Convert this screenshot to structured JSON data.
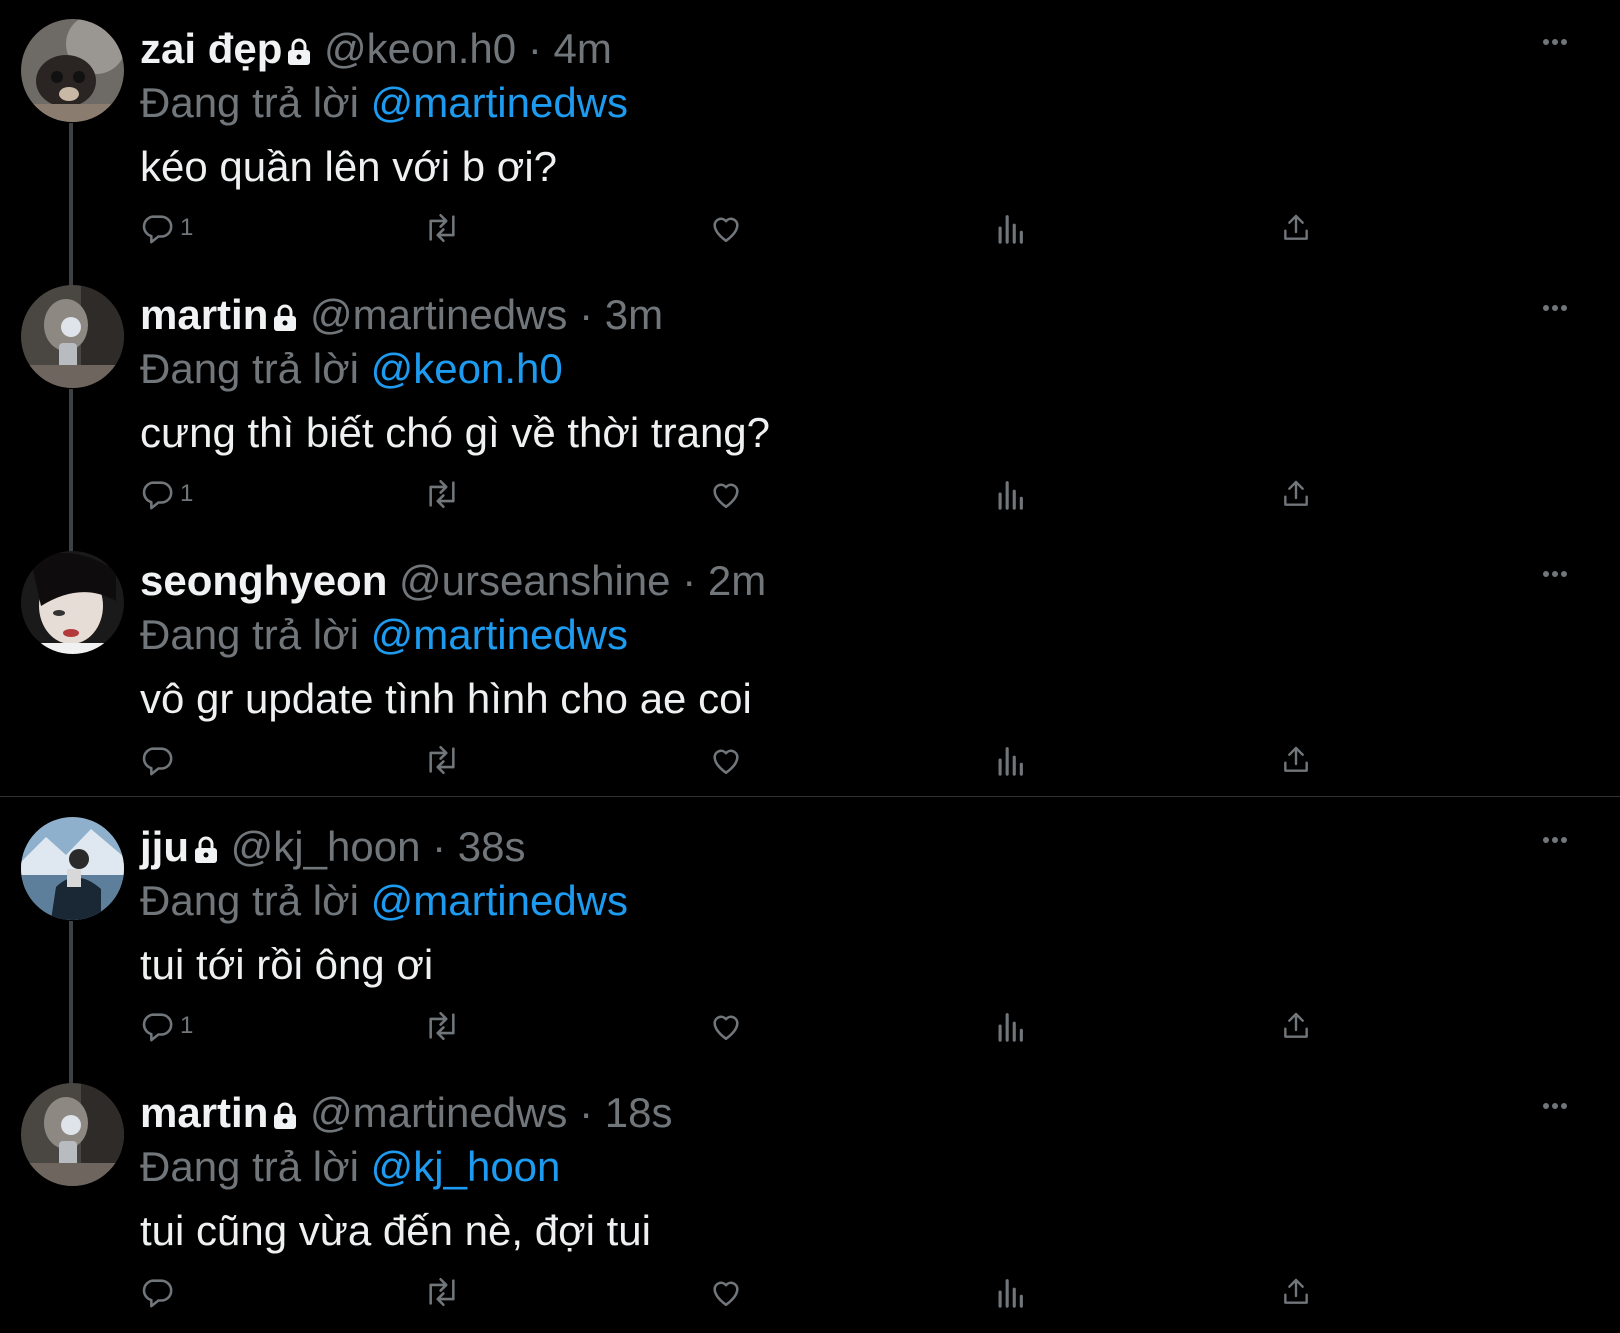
{
  "reply_prefix": "Đang trả lời",
  "tweets": [
    {
      "name": "zai đẹp",
      "locked": true,
      "handle": "@keon.h0",
      "time": "4m",
      "reply_to": "@martinedws",
      "text": "kéo quần lên với b ơi?",
      "reply_count": "1"
    },
    {
      "name": "martin",
      "locked": true,
      "handle": "@martinedws",
      "time": "3m",
      "reply_to": "@keon.h0",
      "text": "cưng thì biết chó gì về thời trang?",
      "reply_count": "1"
    },
    {
      "name": "seonghyeon",
      "locked": false,
      "handle": "@urseanshine",
      "time": "2m",
      "reply_to": "@martinedws",
      "text": "vô gr update tình hình cho ae coi",
      "reply_count": ""
    },
    {
      "name": "jju",
      "locked": true,
      "handle": "@kj_hoon",
      "time": "38s",
      "reply_to": "@martinedws",
      "text": "tui tới rồi ông ơi",
      "reply_count": "1"
    },
    {
      "name": "martin",
      "locked": true,
      "handle": "@martinedws",
      "time": "18s",
      "reply_to": "@kj_hoon",
      "text": "tui cũng vừa đến nè, đợi tui",
      "reply_count": ""
    }
  ],
  "colors": {
    "background": "#000000",
    "text": "#e7e9ea",
    "muted": "#71767b",
    "accent": "#1d9bf0",
    "divider": "#2f3336"
  },
  "icons": [
    "lock-icon",
    "more-icon",
    "reply-icon",
    "retweet-icon",
    "like-icon",
    "views-icon",
    "share-icon"
  ]
}
